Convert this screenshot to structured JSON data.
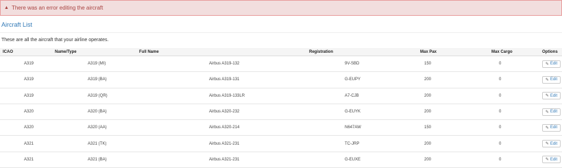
{
  "alert": {
    "icon": "warning-icon",
    "message": "There was an error editing the aircraft",
    "color": "#a94442",
    "background": "#f2dede"
  },
  "page": {
    "title": "Aircraft List",
    "subtitle": "These are all the aircraft that your airline operates."
  },
  "table": {
    "columns": [
      "ICAO",
      "Name/Type",
      "Full Name",
      "Registration",
      "Max Pax",
      "Max Cargo",
      "Options"
    ],
    "edit_label": "Edit",
    "edit_icon": "pencil-icon",
    "rows": [
      {
        "icao": "A319",
        "name": "A319 (MI)",
        "full_name": "Airbus A319-132",
        "registration": "9V-SBD",
        "max_pax": "150",
        "max_cargo": "0"
      },
      {
        "icao": "A319",
        "name": "A319 (BA)",
        "full_name": "Airbus A319-131",
        "registration": "G-EUPY",
        "max_pax": "200",
        "max_cargo": "0"
      },
      {
        "icao": "A319",
        "name": "A319 (QR)",
        "full_name": "Airbus A319-133LR",
        "registration": "A7-CJB",
        "max_pax": "200",
        "max_cargo": "0"
      },
      {
        "icao": "A320",
        "name": "A320 (BA)",
        "full_name": "Airbus A320-232",
        "registration": "G-EUYK",
        "max_pax": "200",
        "max_cargo": "0"
      },
      {
        "icao": "A320",
        "name": "A320 (AA)",
        "full_name": "Airbus A320-214",
        "registration": "N647AW",
        "max_pax": "150",
        "max_cargo": "0"
      },
      {
        "icao": "A321",
        "name": "A321 (TK)",
        "full_name": "Airbus A321-231",
        "registration": "TC-JRP",
        "max_pax": "200",
        "max_cargo": "0"
      },
      {
        "icao": "A321",
        "name": "A321 (BA)",
        "full_name": "Airbus A321-231",
        "registration": "G-EUXE",
        "max_pax": "200",
        "max_cargo": "0"
      }
    ]
  }
}
